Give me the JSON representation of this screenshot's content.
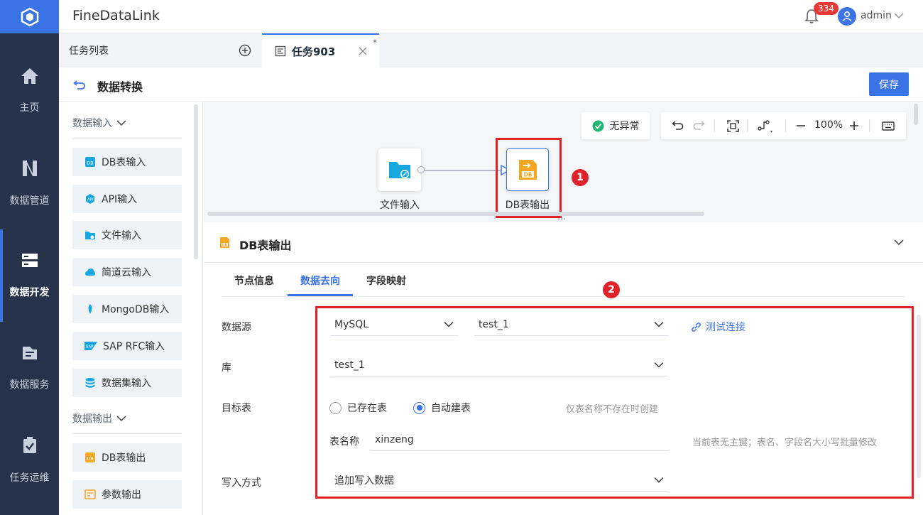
{
  "app": {
    "title": "FineDataLink",
    "notification_count": "334",
    "user": "admin"
  },
  "nav": {
    "items": [
      {
        "label": "主页",
        "icon": "home-icon"
      },
      {
        "label": "数据管道",
        "icon": "pipeline-icon"
      },
      {
        "label": "数据开发",
        "icon": "dev-icon"
      },
      {
        "label": "数据服务",
        "icon": "service-icon"
      },
      {
        "label": "任务运维",
        "icon": "ops-icon"
      }
    ]
  },
  "tabs": {
    "list_label": "任务列表",
    "active_label": "任务903",
    "modified_mark": "*"
  },
  "page": {
    "title": "数据转换",
    "save_label": "保存"
  },
  "left": {
    "input_group": "数据输入",
    "inputs": [
      "DB表输入",
      "API输入",
      "文件输入",
      "简道云输入",
      "MongoDB输入",
      "SAP RFC输入",
      "数据集输入"
    ],
    "output_group": "数据输出",
    "outputs": [
      "DB表输出",
      "参数输出"
    ]
  },
  "canvas": {
    "status": "无异常",
    "zoom": "100%",
    "node_source": "文件输入",
    "node_target": "DB表输出",
    "marker_1": "1"
  },
  "detail": {
    "title": "DB表输出",
    "tabs": [
      "节点信息",
      "数据去向",
      "字段映射"
    ],
    "marker_2": "2",
    "labels": {
      "datasource": "数据源",
      "database": "库",
      "target": "目标表",
      "table_name": "表名称",
      "write_mode": "写入方式"
    },
    "datasource_type": "MySQL",
    "datasource_conn": "test_1",
    "test_link": "测试连接",
    "database": "test_1",
    "target_options": [
      "已存在表",
      "自动建表"
    ],
    "target_hint": "仅表名称不存在时创建",
    "table_name": "xinzeng",
    "table_hint": "当前表无主键；表名、字段名大小写批量修改",
    "write_mode": "追加写入数据"
  }
}
